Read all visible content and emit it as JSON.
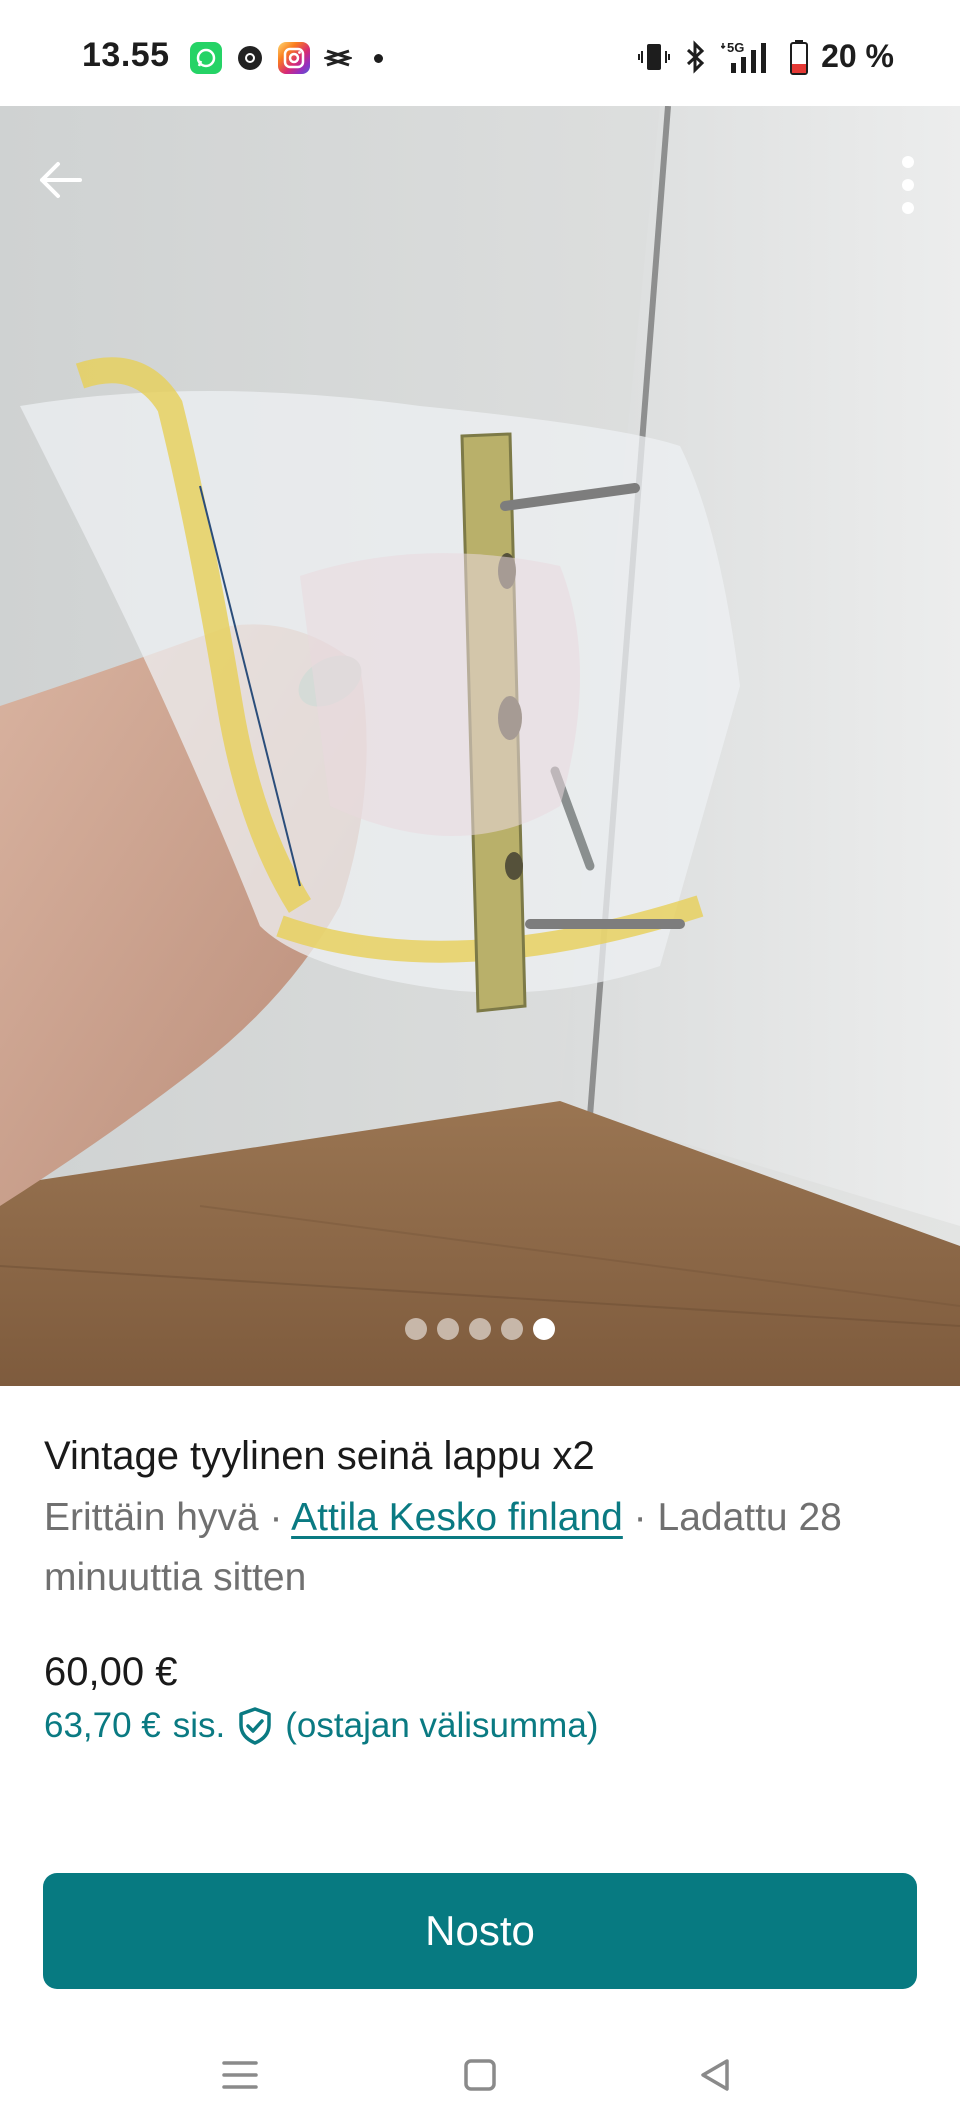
{
  "status_bar": {
    "time": "13.55",
    "battery": "20 %",
    "network": "5G",
    "apps": [
      "whatsapp-icon",
      "chrome-icon",
      "instagram-icon",
      "capcut-icon"
    ]
  },
  "gallery": {
    "image_count": 5,
    "active_index": 4
  },
  "listing": {
    "title": "Vintage tyylinen seinä lappu x2",
    "condition": "Erittäin hyvä",
    "separator": " · ",
    "seller": "Attila Kesko finland",
    "uploaded": "Ladattu 28 minuuttia sitten",
    "price": "60,00 €",
    "buyer_price": "63,70 €",
    "includes_label": "sis.",
    "buyer_note": "(ostajan välisumma)"
  },
  "actions": {
    "primary_label": "Nosto"
  },
  "colors": {
    "accent": "#077a81",
    "link": "#0a7a82",
    "muted_text": "#707070"
  }
}
